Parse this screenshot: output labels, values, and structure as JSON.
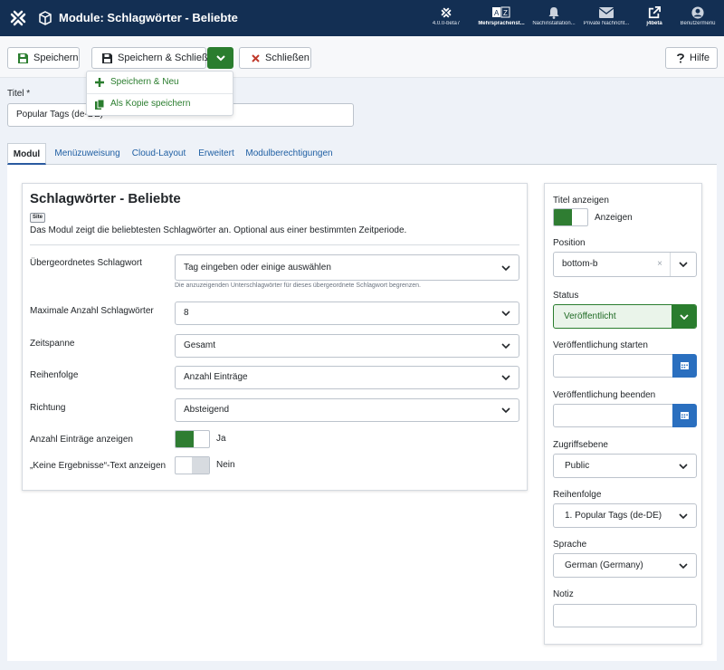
{
  "header": {
    "title": "Module: Schlagwörter - Beliebte",
    "icons": [
      {
        "name": "joomla-version-icon",
        "label": "4.0.0-beta7"
      },
      {
        "name": "multilingual-status-icon",
        "label": "Mehrsprachenst..."
      },
      {
        "name": "post-installation-bell-icon",
        "label": "Nachinstallation..."
      },
      {
        "name": "private-messages-mail-icon",
        "label": "Private Nachricht..."
      },
      {
        "name": "site-external-link-icon",
        "label": "j4beta"
      },
      {
        "name": "user-menu-icon",
        "label": "Benutzermenü"
      }
    ]
  },
  "toolbar": {
    "save": "Speichern",
    "save_close": "Speichern & Schließen",
    "close": "Schließen",
    "help": "Hilfe",
    "dropdown": {
      "save_new": "Speichern & Neu",
      "save_copy": "Als Kopie speichern"
    }
  },
  "title_field": {
    "label": "Titel *",
    "value": "Popular Tags (de-DE)"
  },
  "tabs": [
    "Modul",
    "Menüzuweisung",
    "Cloud-Layout",
    "Erweitert",
    "Modulberechtigungen"
  ],
  "module": {
    "heading": "Schlagwörter - Beliebte",
    "badge": "Site",
    "description": "Das Modul zeigt die beliebtesten Schlagwörter an. Optional aus einer bestimmten Zeitperiode.",
    "fields": {
      "parent_tag": {
        "label": "Übergeordnetes Schlagwort",
        "placeholder": "Tag eingeben oder einige auswählen",
        "help": "Die anzuzeigenden Unterschlagwörter für dieses übergeordnete Schlagwort begrenzen."
      },
      "max_tags": {
        "label": "Maximale Anzahl Schlagwörter",
        "value": "8"
      },
      "timeframe": {
        "label": "Zeitspanne",
        "value": "Gesamt"
      },
      "order": {
        "label": "Reihenfolge",
        "value": "Anzahl Einträge"
      },
      "direction": {
        "label": "Richtung",
        "value": "Absteigend"
      },
      "show_count": {
        "label": "Anzahl Einträge anzeigen",
        "value": "Ja"
      },
      "no_results": {
        "label": "„Keine Ergebnisse“-Text anzeigen",
        "value": "Nein"
      }
    }
  },
  "sidebar": {
    "show_title": {
      "label": "Titel anzeigen",
      "value": "Anzeigen"
    },
    "position": {
      "label": "Position",
      "value": "bottom-b",
      "clear": "×"
    },
    "status": {
      "label": "Status",
      "value": "Veröffentlicht"
    },
    "publish_up": {
      "label": "Veröffentlichung starten",
      "value": ""
    },
    "publish_down": {
      "label": "Veröffentlichung beenden",
      "value": ""
    },
    "access": {
      "label": "Zugriffsebene",
      "value": "Public"
    },
    "ordering": {
      "label": "Reihenfolge",
      "value": "1. Popular Tags (de-DE)"
    },
    "language": {
      "label": "Sprache",
      "value": "German (Germany)"
    },
    "note": {
      "label": "Notiz",
      "value": ""
    }
  },
  "colors": {
    "header_bg": "#132f53",
    "accent_green": "#2a7d2e",
    "accent_blue": "#2a6fbf",
    "link": "#1f5fa3"
  }
}
